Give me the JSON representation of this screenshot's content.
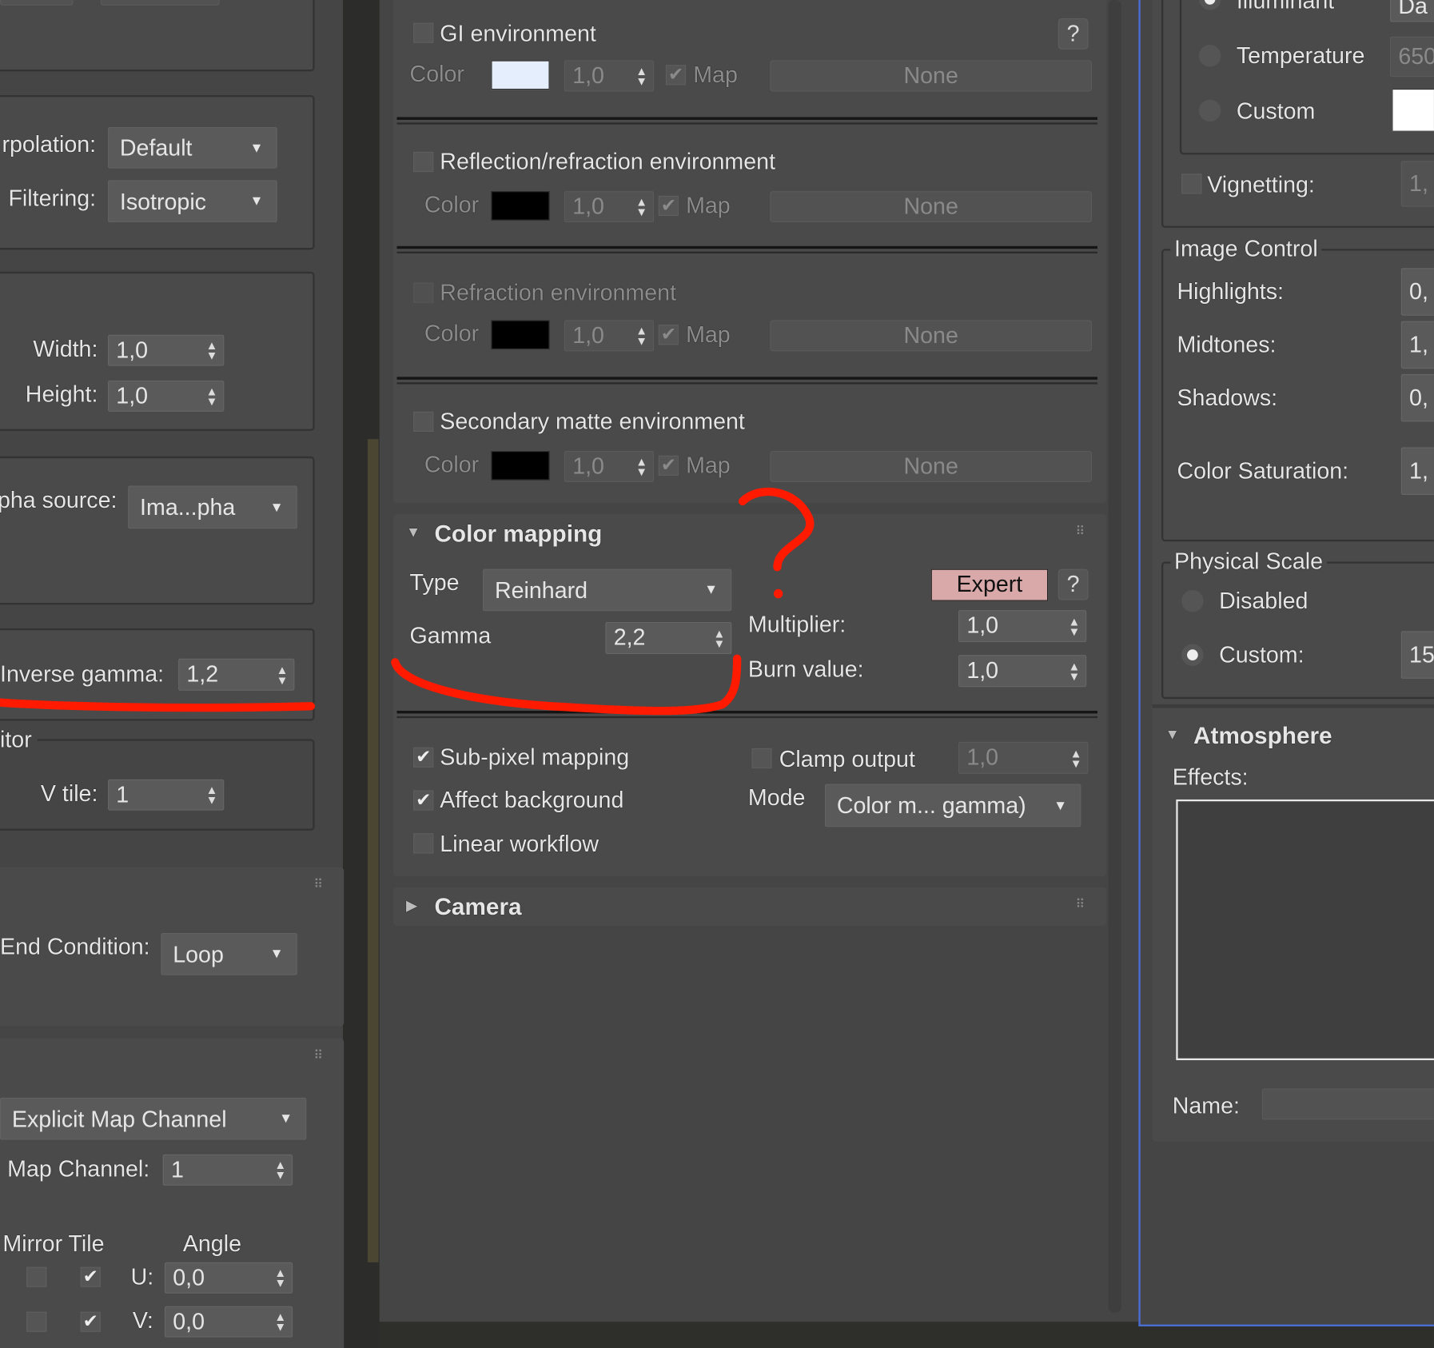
{
  "left": {
    "interpolation_label": "rpolation:",
    "interpolation_value": "Default",
    "filtering_label": "Filtering:",
    "filtering_value": "Isotropic",
    "width_label": "Width:",
    "width_value": "1,0",
    "height_label": "Height:",
    "height_value": "1,0",
    "alpha_source_label": "pha source:",
    "alpha_source_value": "Ima...pha",
    "inverse_gamma_label": "Inverse gamma:",
    "inverse_gamma_value": "1,2",
    "monitor_group": "itor",
    "v_tile_label": "V tile:",
    "v_tile_value": "1",
    "end_condition_label": "End Condition:",
    "end_condition_value": "Loop",
    "map_channel_type": "Explicit Map Channel",
    "map_channel_label": "Map Channel:",
    "map_channel_value": "1",
    "mirror_tile_label": "Mirror Tile",
    "angle_label": "Angle",
    "u_label": "U:",
    "u_value": "0,0",
    "v_label": "V:",
    "v_value": "0,0"
  },
  "environment": {
    "rows": [
      {
        "title": "GI environment",
        "color_label": "Color",
        "swatch": "#e4eefc",
        "amount": "1,0",
        "map_label": "Map",
        "map_button": "None"
      },
      {
        "title": "Reflection/refraction environment",
        "color_label": "Color",
        "swatch": "#000000",
        "amount": "1,0",
        "map_label": "Map",
        "map_button": "None"
      },
      {
        "title": "Refraction environment",
        "color_label": "Color",
        "swatch": "#000000",
        "amount": "1,0",
        "map_label": "Map",
        "map_button": "None"
      },
      {
        "title": "Secondary matte environment",
        "color_label": "Color",
        "swatch": "#000000",
        "amount": "1,0",
        "map_label": "Map",
        "map_button": "None"
      }
    ],
    "help": "?"
  },
  "color_mapping": {
    "title": "Color mapping",
    "type_label": "Type",
    "type_value": "Reinhard",
    "expert_button": "Expert",
    "help": "?",
    "gamma_label": "Gamma",
    "gamma_value": "2,2",
    "multiplier_label": "Multiplier:",
    "multiplier_value": "1,0",
    "burn_label": "Burn value:",
    "burn_value": "1,0",
    "subpixel_label": "Sub-pixel mapping",
    "affect_bg_label": "Affect background",
    "linear_label": "Linear workflow",
    "clamp_label": "Clamp output",
    "clamp_value": "1,0",
    "mode_label": "Mode",
    "mode_value": "Color m... gamma)"
  },
  "camera": {
    "title": "Camera"
  },
  "right": {
    "illuminant_label": "Illuminant",
    "illuminant_value": "Da",
    "temperature_label": "Temperature",
    "temperature_value": "650",
    "custom_label": "Custom",
    "custom_swatch": "#ffffff",
    "vignetting_label": "Vignetting:",
    "vignetting_value": "1,",
    "image_control_title": "Image Control",
    "highlights_label": "Highlights:",
    "highlights_value": "0,",
    "midtones_label": "Midtones:",
    "midtones_value": "1,",
    "shadows_label": "Shadows:",
    "shadows_value": "0,",
    "saturation_label": "Color Saturation:",
    "saturation_value": "1,",
    "physical_scale_title": "Physical Scale",
    "disabled_label": "Disabled",
    "custom_scale_label": "Custom:",
    "custom_scale_value": "15",
    "atmosphere_title": "Atmosphere",
    "effects_label": "Effects:",
    "name_label": "Name:"
  },
  "colors": {
    "annotation": "#ff1a00",
    "expert": "#d9a9a9",
    "selection_border": "#4a6fd8"
  }
}
